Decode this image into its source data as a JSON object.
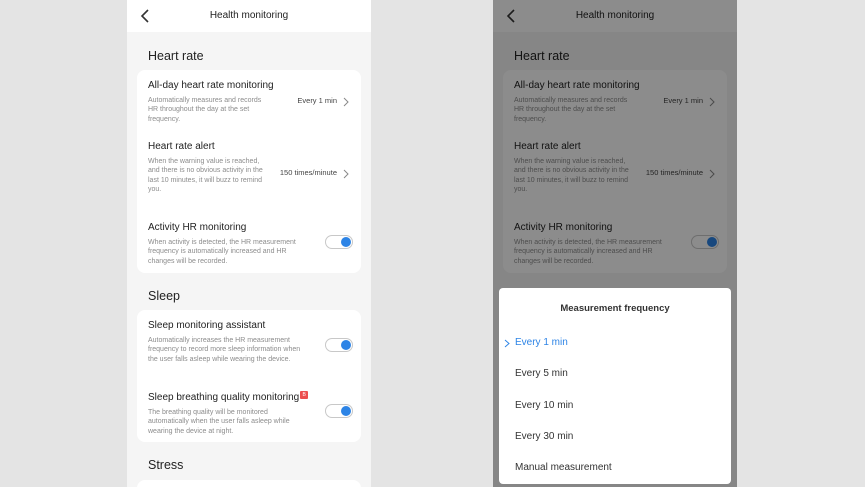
{
  "screen": {
    "title": "Health monitoring",
    "heart_rate_section": "Heart rate",
    "sleep_section": "Sleep",
    "stress_section": "Stress",
    "all_day": {
      "title": "All-day heart rate monitoring",
      "desc": "Automatically measures and records HR throughout the day at the set frequency.",
      "value": "Every 1 min"
    },
    "hr_alert": {
      "title": "Heart rate alert",
      "desc": "When the warning value is reached, and there is no obvious activity in the last 10 minutes, it will buzz to remind you.",
      "value": "150 times/minute"
    },
    "activity_hr": {
      "title": "Activity HR monitoring",
      "desc": "When activity is detected, the HR measurement frequency is automatically increased and HR changes will be recorded.",
      "enabled": true
    },
    "sleep_assistant": {
      "title": "Sleep monitoring assistant",
      "desc": "Automatically increases the HR measurement frequency to record more sleep information when the user falls asleep while wearing the device.",
      "enabled": true
    },
    "sleep_breathing": {
      "title": "Sleep breathing quality monitoring",
      "badge": "B",
      "desc": "The breathing quality will be monitored automatically when the user falls asleep while wearing the device at night.",
      "enabled": true
    }
  },
  "sheet": {
    "title": "Measurement frequency",
    "options": [
      "Every 1 min",
      "Every 5 min",
      "Every 10 min",
      "Every 30 min",
      "Manual measurement"
    ],
    "selected": "Every 1 min"
  },
  "icons": {
    "back": "back-arrow-icon",
    "chevron": "chevron-right-icon",
    "check": "selected-check-icon"
  },
  "colors": {
    "accent": "#2d84e6",
    "badge": "#ec4f4f",
    "background": "#f5f5f5"
  }
}
